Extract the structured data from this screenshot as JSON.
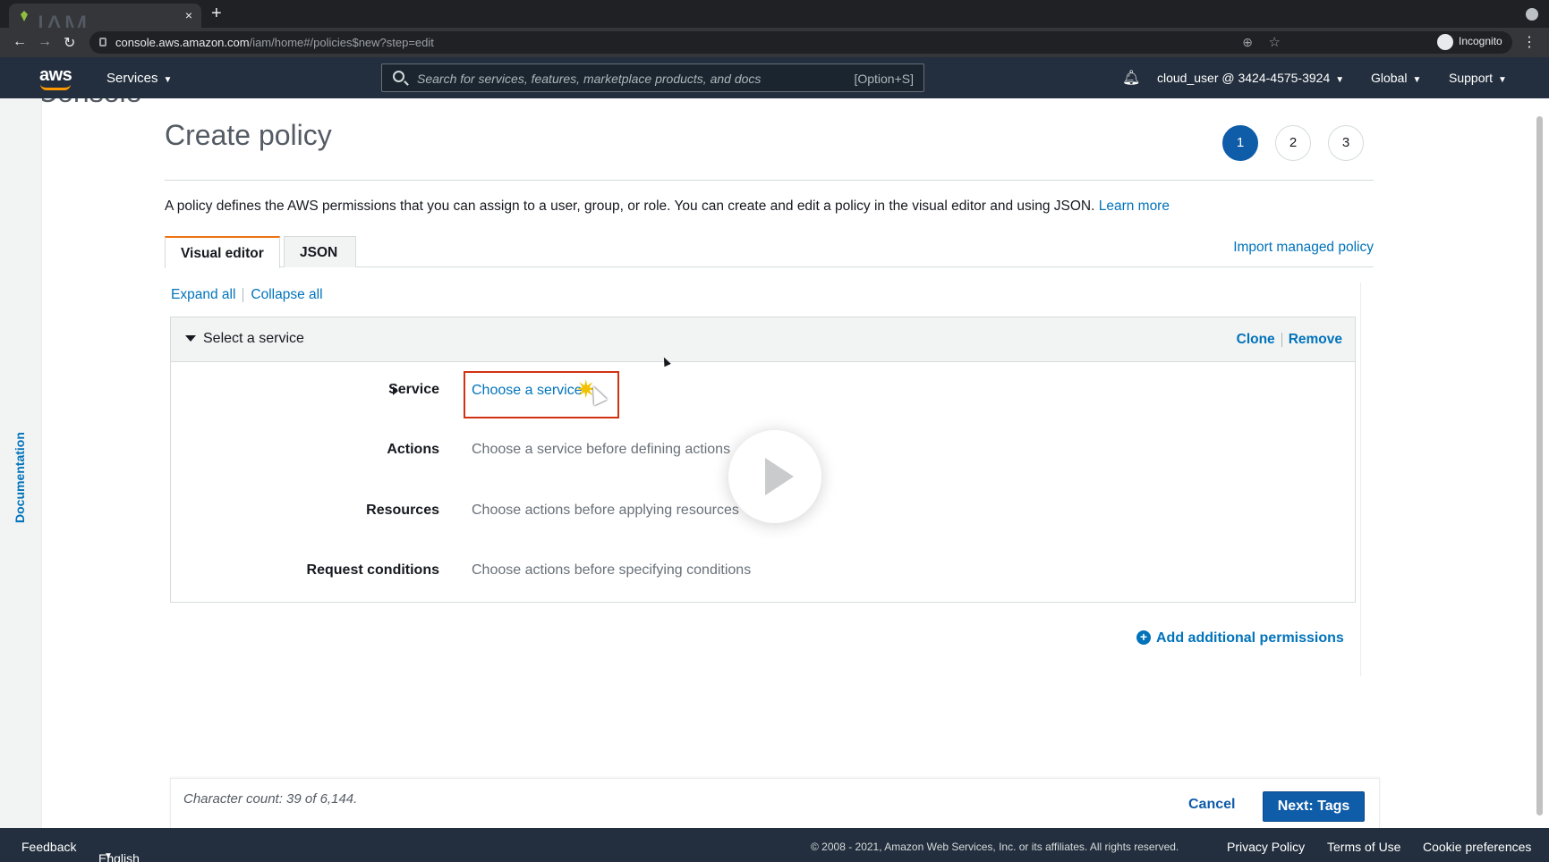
{
  "browser": {
    "tab_title": "IAM Management Console",
    "tab_close": "×",
    "new_tab": "+",
    "url_host": "console.aws.amazon.com",
    "url_path": "/iam/home#/policies$new?step=edit",
    "incognito_label": "Incognito"
  },
  "aws_nav": {
    "logo": "aws",
    "services_label": "Services",
    "search_placeholder": "Search for services, features, marketplace products, and docs",
    "search_shortcut": "[Option+S]",
    "account_label": "cloud_user @ 3424-4575-3924",
    "region_label": "Global",
    "support_label": "Support"
  },
  "doc_rail": {
    "label": "Documentation"
  },
  "page": {
    "title": "Create policy",
    "steps": [
      "1",
      "2",
      "3"
    ],
    "active_step": "1",
    "description": "A policy defines the AWS permissions that you can assign to a user, group, or role. You can create and edit a policy in the visual editor and using JSON.",
    "learn_more": "Learn more",
    "tabs": [
      {
        "label": "Visual editor",
        "active": true
      },
      {
        "label": "JSON",
        "active": false
      }
    ],
    "import_link": "Import managed policy",
    "expand_all": "Expand all",
    "collapse_all": "Collapse all"
  },
  "panel": {
    "header": "Select a service",
    "clone": "Clone",
    "remove": "Remove",
    "rows": [
      {
        "label": "Service",
        "value": "Choose a service"
      },
      {
        "label": "Actions",
        "value": "Choose a service before defining actions"
      },
      {
        "label": "Resources",
        "value": "Choose actions before applying resources"
      },
      {
        "label": "Request conditions",
        "value": "Choose actions before specifying conditions"
      }
    ]
  },
  "add_permissions": "Add additional permissions",
  "footer_bar": {
    "char_count": "Character count: 39 of 6,144.",
    "cancel": "Cancel",
    "next": "Next: Tags"
  },
  "aws_footer": {
    "feedback": "Feedback",
    "language": "English (US)",
    "copyright": "© 2008 - 2021, Amazon Web Services, Inc. or its affiliates. All rights reserved.",
    "privacy": "Privacy Policy",
    "terms": "Terms of Use",
    "cookies": "Cookie preferences"
  },
  "colors": {
    "aws_nav_bg": "#232f3e",
    "primary_blue": "#0f5ca8",
    "link_blue": "#0073bb",
    "tab_accent": "#ec7211",
    "highlight_red": "#d13212"
  },
  "icons": [
    "favicon-icon",
    "back-icon",
    "forward-icon",
    "reload-icon",
    "lock-icon",
    "zoom-icon",
    "star-icon",
    "incognito-icon",
    "kebab-icon",
    "search-icon",
    "bell-icon",
    "caret-down-icon",
    "expand-triangle-icon",
    "plus-circle-icon",
    "play-icon",
    "cursor-icon",
    "sparkle-icon"
  ]
}
